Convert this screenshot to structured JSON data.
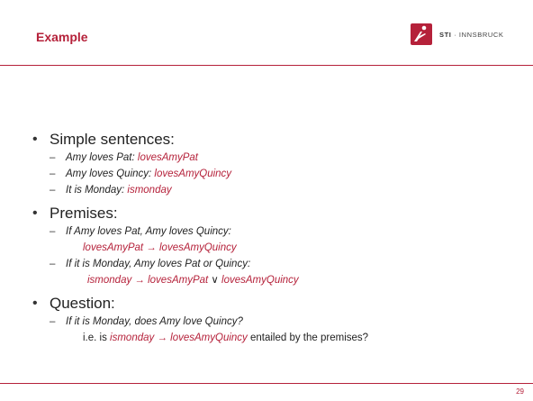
{
  "slide": {
    "title": "Example",
    "logo_text_bold": "STI",
    "logo_text_rest": " · INNSBRUCK",
    "page_number": "29",
    "accent_color": "#b5213a"
  },
  "bullets": {
    "simple": {
      "heading": "Simple sentences:",
      "items": [
        {
          "prefix": "Amy loves Pat: ",
          "symbol": "lovesAmyPat"
        },
        {
          "prefix": "Amy loves Quincy: ",
          "symbol": "lovesAmyQuincy"
        },
        {
          "prefix": "It is Monday: ",
          "symbol": "ismonday"
        }
      ]
    },
    "premises": {
      "heading": "Premises:",
      "p1_text": "If Amy loves Pat, Amy loves Quincy:",
      "p1_formula": "lovesAmyPat → lovesAmyQuincy",
      "p2_text": "If it is Monday, Amy loves Pat or Quincy:",
      "p2_formula_a": "ismonday → ",
      "p2_formula_b": " lovesAmyPat",
      "p2_or": " ∨ ",
      "p2_formula_c": "lovesAmyQuincy"
    },
    "question": {
      "heading": "Question:",
      "q_text": "If it is Monday, does Amy love Quincy?",
      "ie_prefix": "i.e. is ",
      "ie_formula": "ismonday → lovesAmyQuincy",
      "ie_suffix": " entailed by the premises?"
    }
  }
}
